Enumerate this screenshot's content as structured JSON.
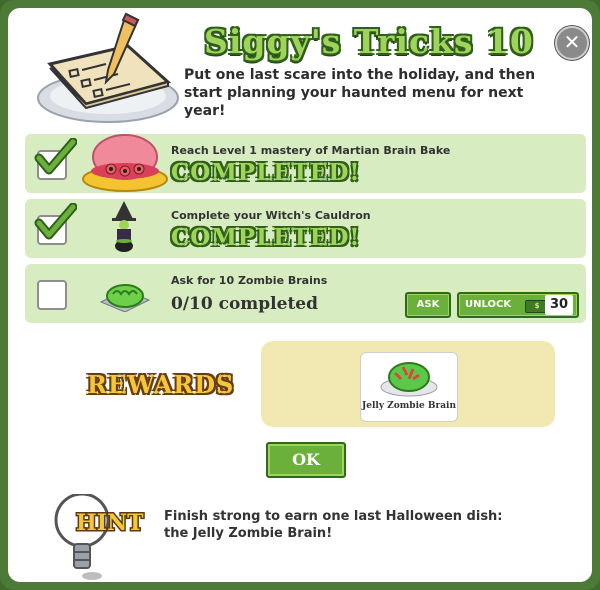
{
  "dialog": {
    "title": "Siggy's Tricks 10",
    "subtitle": "Put one last scare into the holiday, and then start planning your haunted menu for next year!",
    "close_symbol": "✕"
  },
  "tasks": [
    {
      "description": "Reach Level 1 mastery of Martian Brain Bake",
      "status": "COMPLETED!",
      "checked": true,
      "icon": "martian-brain-bake-icon"
    },
    {
      "description": "Complete your Witch's Cauldron",
      "status": "COMPLETED!",
      "checked": true,
      "icon": "witch-cauldron-icon"
    },
    {
      "description": "Ask for 10 Zombie Brains",
      "progress": "0/10 completed",
      "checked": false,
      "icon": "zombie-brain-icon",
      "ask_label": "ASK",
      "unlock_label": "UNLOCK",
      "unlock_cost": "30"
    }
  ],
  "rewards": {
    "label": "REWARDS",
    "items": [
      {
        "name": "Jelly Zombie Brain",
        "icon": "jelly-zombie-brain-icon"
      }
    ]
  },
  "ok_label": "OK",
  "hint": {
    "label": "HINT",
    "text": "Finish strong to earn one last Halloween dish: the Jelly Zombie Brain!"
  },
  "colors": {
    "accent_green": "#6cb03c",
    "task_bg": "#d7ecc1",
    "reward_bg": "#f1e8b2",
    "title_fill": "#9fd45a",
    "frame": "#4d7a36"
  }
}
